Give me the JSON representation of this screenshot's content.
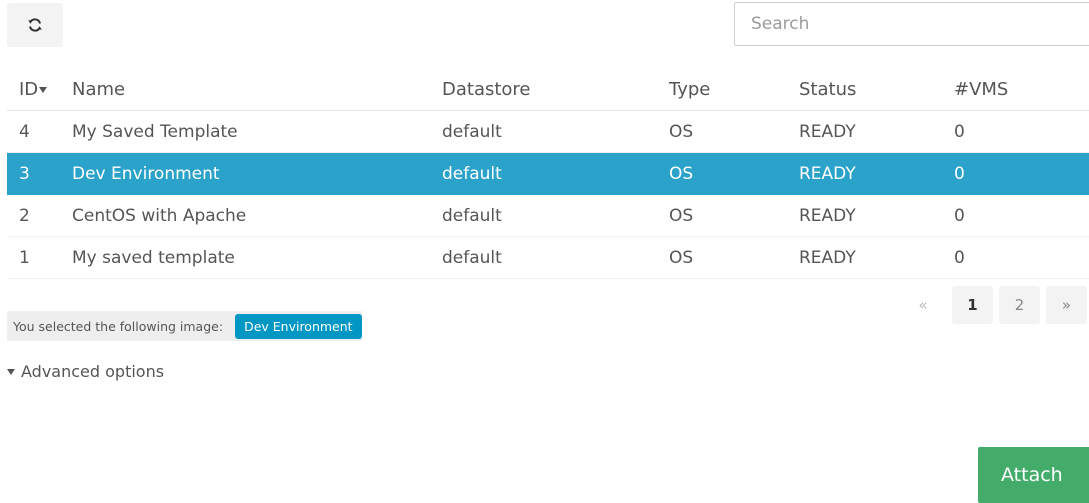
{
  "toolbar": {
    "refresh_icon": "refresh-icon"
  },
  "search": {
    "placeholder": "Search",
    "value": ""
  },
  "table": {
    "columns": [
      "ID",
      "Name",
      "Datastore",
      "Type",
      "Status",
      "#VMS"
    ],
    "rows": [
      {
        "id": "4",
        "name": "My Saved Template",
        "datastore": "default",
        "type": "OS",
        "status": "READY",
        "vms": "0",
        "selected": false
      },
      {
        "id": "3",
        "name": "Dev Environment",
        "datastore": "default",
        "type": "OS",
        "status": "READY",
        "vms": "0",
        "selected": true
      },
      {
        "id": "2",
        "name": "CentOS with Apache",
        "datastore": "default",
        "type": "OS",
        "status": "READY",
        "vms": "0",
        "selected": false
      },
      {
        "id": "1",
        "name": "My saved template",
        "datastore": "default",
        "type": "OS",
        "status": "READY",
        "vms": "0",
        "selected": false
      }
    ],
    "selected_color": "#2ba2c9"
  },
  "selection": {
    "label": "You selected the following image:",
    "value": "Dev Environment"
  },
  "pagination": {
    "prev": "«",
    "pages": [
      "1",
      "2"
    ],
    "current": "1",
    "next": "»"
  },
  "advanced": {
    "label": "Advanced options"
  },
  "actions": {
    "attach_label": "Attach",
    "attach_color": "#43ac6a"
  }
}
